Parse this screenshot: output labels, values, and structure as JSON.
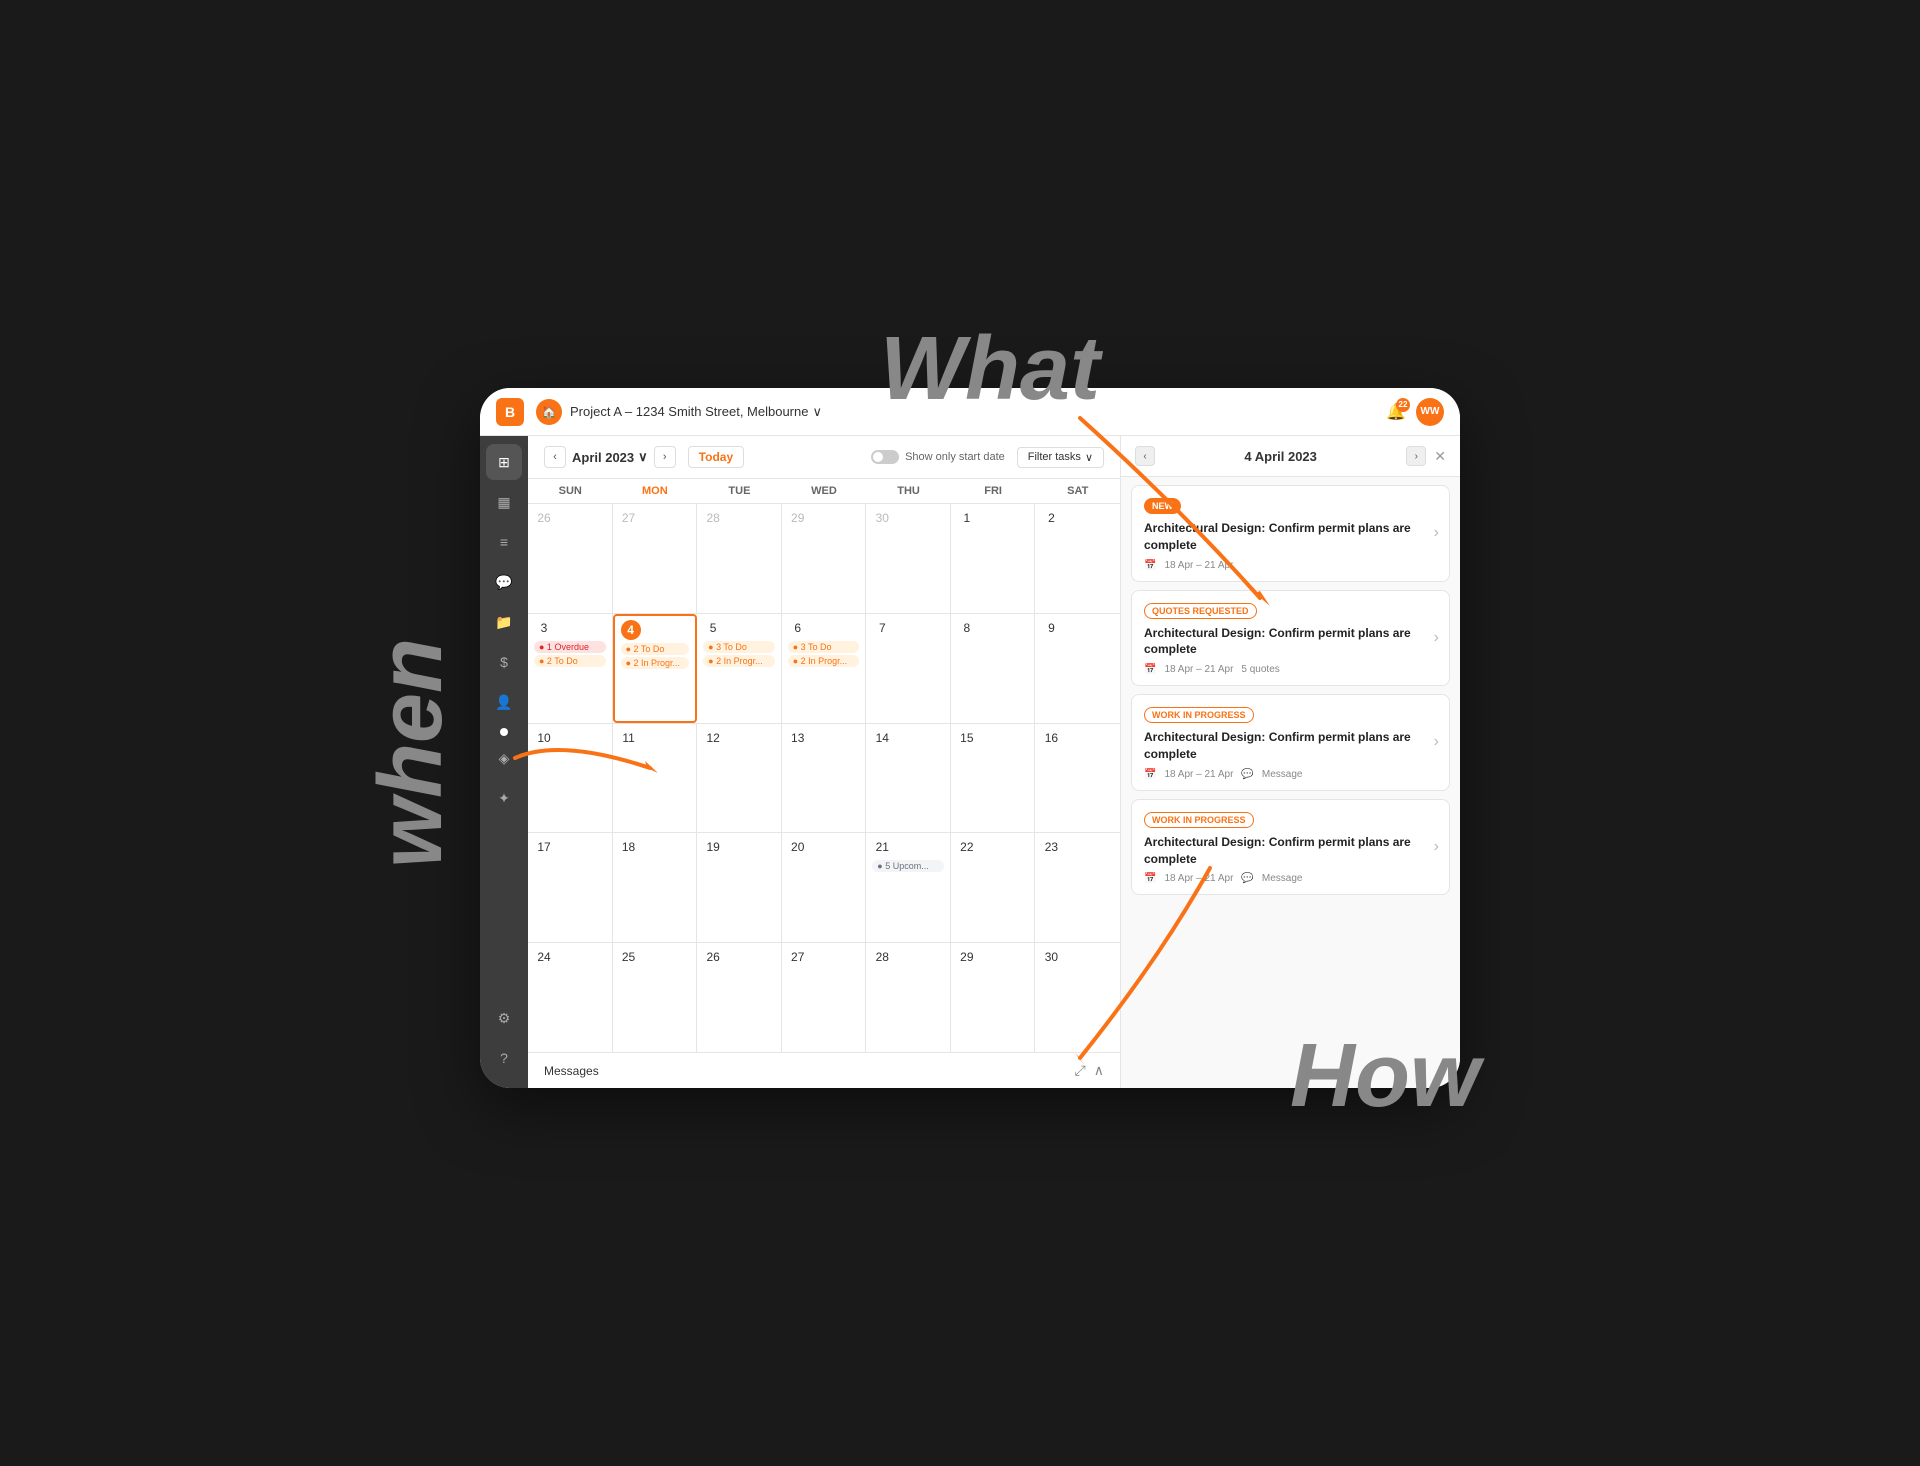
{
  "annotations": {
    "what": "What",
    "when": "when",
    "how": "How"
  },
  "topNav": {
    "logoText": "B",
    "projectName": "Project A – 1234 Smith Street, Melbourne",
    "notificationCount": "22",
    "avatarText": "WW"
  },
  "calendarHeader": {
    "prevBtn": "‹",
    "nextBtn": "›",
    "monthLabel": "April 2023",
    "chevron": "∨",
    "todayBtn": "Today",
    "toggleLabel": "Show only start date",
    "filterBtn": "Filter tasks",
    "filterChevron": "∨"
  },
  "rightPanel": {
    "prevBtn": "‹",
    "nextBtn": "›",
    "dateLabel": "4 April 2023",
    "closeBtn": "✕",
    "items": [
      {
        "badge": "NEW",
        "badgeType": "new",
        "title": "Architectural Design: Confirm permit plans are complete",
        "dateRange": "18 Apr – 21 Apr",
        "extra": null
      },
      {
        "badge": "QUOTES REQUESTED",
        "badgeType": "quotes",
        "title": "Architectural Design: Confirm permit plans are complete",
        "dateRange": "18 Apr – 21 Apr",
        "extra": "5 quotes"
      },
      {
        "badge": "WORK IN PROGRESS",
        "badgeType": "wip",
        "title": "Architectural Design: Confirm permit plans are complete",
        "dateRange": "18 Apr – 21 Apr",
        "extra": "Message"
      },
      {
        "badge": "WORK IN PROGRESS",
        "badgeType": "wip",
        "title": "Architectural Design: Confirm permit plans are complete",
        "dateRange": "18 Apr – 21 Apr",
        "extra": "Message"
      }
    ]
  },
  "dayHeaders": [
    "SUN",
    "MON",
    "TUE",
    "WED",
    "THU",
    "FRI",
    "SAT"
  ],
  "calendarRows": [
    [
      {
        "date": "26",
        "otherMonth": true,
        "tasks": []
      },
      {
        "date": "27",
        "otherMonth": true,
        "tasks": []
      },
      {
        "date": "28",
        "otherMonth": true,
        "tasks": []
      },
      {
        "date": "29",
        "otherMonth": true,
        "tasks": []
      },
      {
        "date": "30",
        "otherMonth": true,
        "tasks": []
      },
      {
        "date": "1",
        "otherMonth": false,
        "tasks": []
      },
      {
        "date": "2",
        "otherMonth": false,
        "tasks": []
      }
    ],
    [
      {
        "date": "3",
        "otherMonth": false,
        "tasks": [
          {
            "label": "● 1 Overdue",
            "type": "overdue"
          },
          {
            "label": "● 2 To Do",
            "type": "todo"
          }
        ]
      },
      {
        "date": "4",
        "otherMonth": false,
        "today": true,
        "selected": true,
        "tasks": [
          {
            "label": "● 2 To Do",
            "type": "todo"
          },
          {
            "label": "● 2 In Progr...",
            "type": "inprogress"
          }
        ]
      },
      {
        "date": "5",
        "otherMonth": false,
        "tasks": [
          {
            "label": "● 3 To Do",
            "type": "todo"
          },
          {
            "label": "● 2 In Progr...",
            "type": "inprogress"
          }
        ]
      },
      {
        "date": "6",
        "otherMonth": false,
        "tasks": [
          {
            "label": "● 3 To Do",
            "type": "todo"
          },
          {
            "label": "● 2 In Progr...",
            "type": "inprogress"
          }
        ]
      },
      {
        "date": "7",
        "otherMonth": false,
        "tasks": []
      },
      {
        "date": "8",
        "otherMonth": false,
        "tasks": []
      },
      {
        "date": "9",
        "otherMonth": false,
        "tasks": []
      }
    ],
    [
      {
        "date": "10",
        "otherMonth": false,
        "tasks": []
      },
      {
        "date": "11",
        "otherMonth": false,
        "tasks": []
      },
      {
        "date": "12",
        "otherMonth": false,
        "tasks": []
      },
      {
        "date": "13",
        "otherMonth": false,
        "tasks": []
      },
      {
        "date": "14",
        "otherMonth": false,
        "tasks": []
      },
      {
        "date": "15",
        "otherMonth": false,
        "tasks": []
      },
      {
        "date": "16",
        "otherMonth": false,
        "tasks": []
      }
    ],
    [
      {
        "date": "17",
        "otherMonth": false,
        "tasks": []
      },
      {
        "date": "18",
        "otherMonth": false,
        "tasks": []
      },
      {
        "date": "19",
        "otherMonth": false,
        "tasks": []
      },
      {
        "date": "20",
        "otherMonth": false,
        "tasks": []
      },
      {
        "date": "21",
        "otherMonth": false,
        "tasks": [
          {
            "label": "● 5 Upcom...",
            "type": "upcoming"
          }
        ]
      },
      {
        "date": "22",
        "otherMonth": false,
        "tasks": []
      },
      {
        "date": "23",
        "otherMonth": false,
        "tasks": []
      }
    ],
    [
      {
        "date": "24",
        "otherMonth": false,
        "tasks": []
      },
      {
        "date": "25",
        "otherMonth": false,
        "tasks": []
      },
      {
        "date": "26",
        "otherMonth": false,
        "tasks": []
      },
      {
        "date": "27",
        "otherMonth": false,
        "tasks": []
      },
      {
        "date": "28",
        "otherMonth": false,
        "tasks": []
      },
      {
        "date": "29",
        "otherMonth": false,
        "tasks": []
      },
      {
        "date": "30",
        "otherMonth": false,
        "tasks": []
      }
    ]
  ],
  "messagesBar": {
    "label": "Messages",
    "expandIcon": "⤢",
    "collapseIcon": "∧"
  },
  "sidebar": {
    "items": [
      {
        "icon": "⊞",
        "label": "grid-icon",
        "active": true
      },
      {
        "icon": "📅",
        "label": "calendar-icon",
        "active": false
      },
      {
        "icon": "≡",
        "label": "list-icon",
        "active": false
      },
      {
        "icon": "💬",
        "label": "message-icon",
        "active": false
      },
      {
        "icon": "📁",
        "label": "folder-icon",
        "active": false
      },
      {
        "icon": "$",
        "label": "finance-icon",
        "active": false
      },
      {
        "icon": "👤",
        "label": "people-icon",
        "active": false
      },
      {
        "icon": "◈",
        "label": "layers-icon",
        "active": false
      },
      {
        "icon": "✦",
        "label": "star-icon",
        "active": false
      }
    ],
    "bottomItems": [
      {
        "icon": "⚙",
        "label": "settings-icon"
      },
      {
        "icon": "?",
        "label": "help-icon"
      }
    ]
  }
}
